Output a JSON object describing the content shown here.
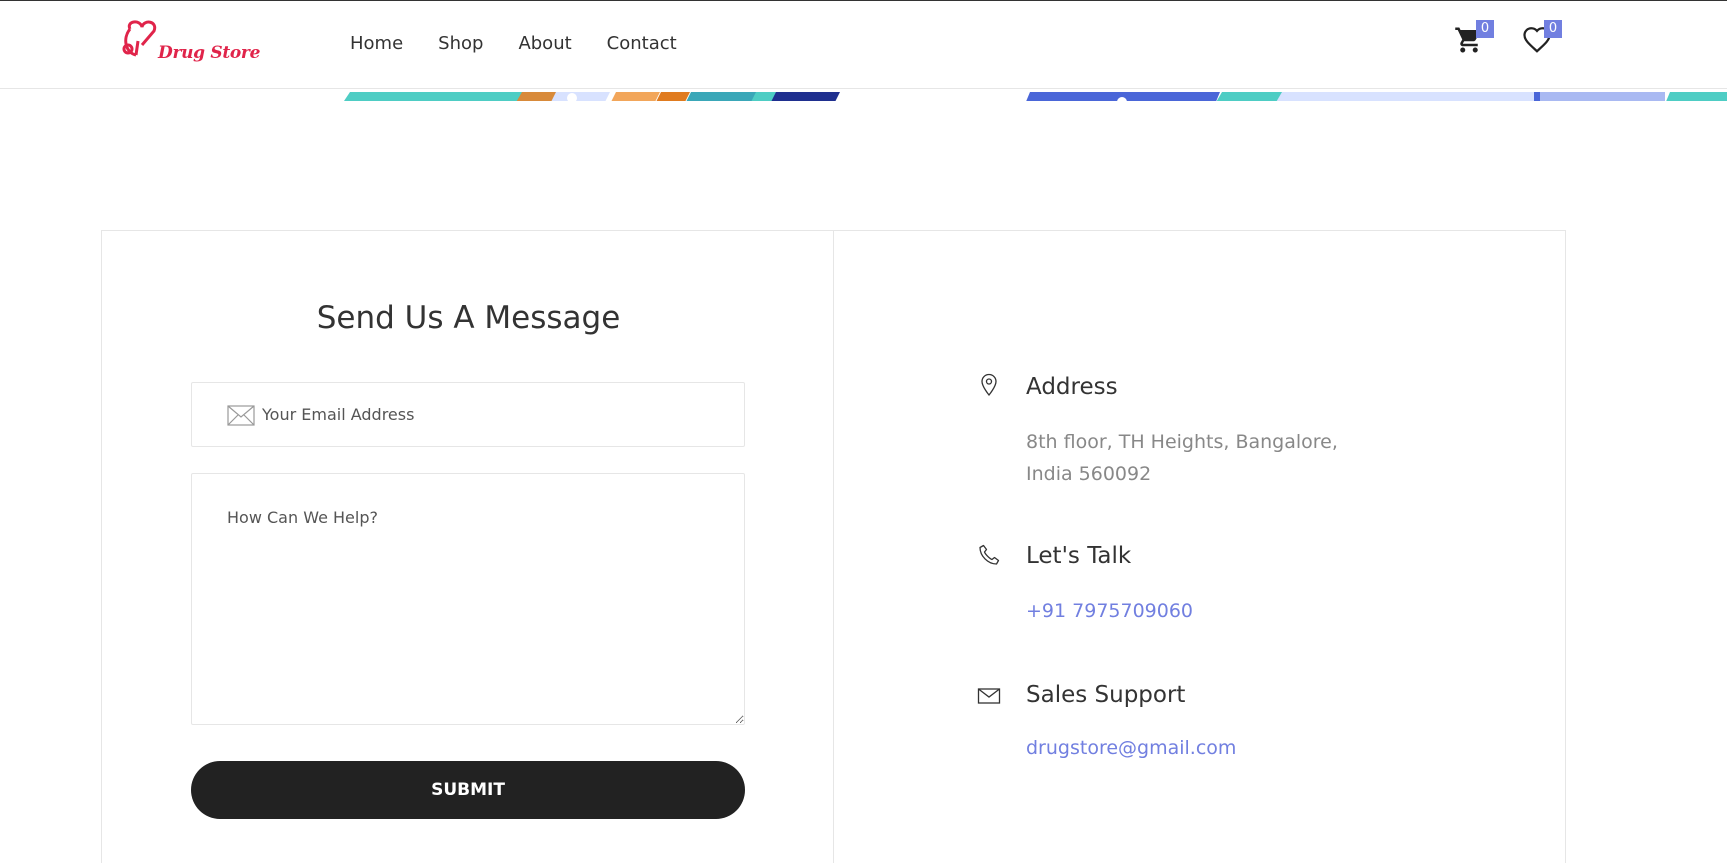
{
  "brand": {
    "name": "Drug Store"
  },
  "nav": {
    "items": [
      {
        "label": "Home"
      },
      {
        "label": "Shop"
      },
      {
        "label": "About"
      },
      {
        "label": "Contact"
      }
    ]
  },
  "header_icons": {
    "cart": {
      "icon": "cart-icon",
      "count": "0"
    },
    "wishlist": {
      "icon": "heart-icon",
      "count": "0"
    }
  },
  "form": {
    "title": "Send Us A Message",
    "email_placeholder": "Your Email Address",
    "message_placeholder": "How Can We Help?",
    "submit_label": "SUBMIT"
  },
  "contact_info": {
    "address": {
      "icon": "map-pin-icon",
      "title": "Address",
      "line1": "8th floor, TH Heights, Bangalore,",
      "line2": "India 560092"
    },
    "talk": {
      "icon": "phone-icon",
      "title": "Let's Talk",
      "phone": "+91 7975709060"
    },
    "support": {
      "icon": "envelope-icon",
      "title": "Sales Support",
      "email": "drugstore@gmail.com"
    }
  },
  "colors": {
    "brand_red": "#e0244a",
    "accent": "#717fe0",
    "button_dark": "#222222"
  }
}
